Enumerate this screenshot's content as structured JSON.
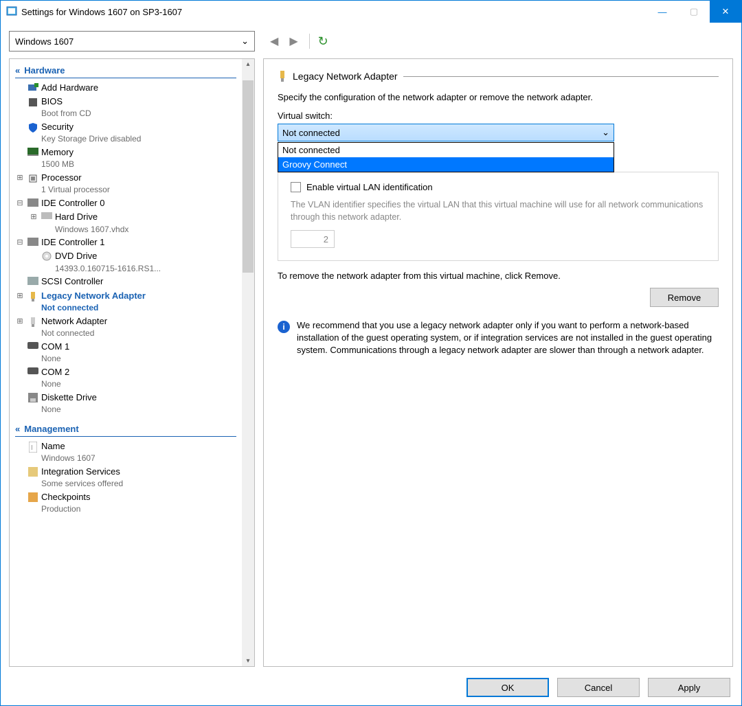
{
  "title": "Settings for Windows 1607 on SP3-1607",
  "vm_selector": "Windows 1607",
  "sidebar": {
    "sections": {
      "hardware": "Hardware",
      "management": "Management"
    },
    "items": {
      "add_hw": "Add Hardware",
      "bios": "BIOS",
      "bios_sub": "Boot from CD",
      "security": "Security",
      "security_sub": "Key Storage Drive disabled",
      "memory": "Memory",
      "memory_sub": "1500 MB",
      "processor": "Processor",
      "processor_sub": "1 Virtual processor",
      "ide0": "IDE Controller 0",
      "hard_drive": "Hard Drive",
      "hard_drive_sub": "Windows 1607.vhdx",
      "ide1": "IDE Controller 1",
      "dvd": "DVD Drive",
      "dvd_sub": "14393.0.160715-1616.RS1...",
      "scsi": "SCSI Controller",
      "legacy_na": "Legacy Network Adapter",
      "legacy_na_sub": "Not connected",
      "net_adapter": "Network Adapter",
      "net_adapter_sub": "Not connected",
      "com1": "COM 1",
      "com1_sub": "None",
      "com2": "COM 2",
      "com2_sub": "None",
      "diskette": "Diskette Drive",
      "diskette_sub": "None",
      "name": "Name",
      "name_sub": "Windows 1607",
      "integ": "Integration Services",
      "integ_sub": "Some services offered",
      "checkpoints": "Checkpoints",
      "checkpoints_sub": "Production"
    }
  },
  "panel": {
    "title": "Legacy Network Adapter",
    "desc": "Specify the configuration of the network adapter or remove the network adapter.",
    "vswitch_label": "Virtual switch:",
    "vswitch_value": "Not connected",
    "vswitch_options": {
      "o0": "Not connected",
      "o1": "Groovy Connect"
    },
    "vlan_check_label": "Enable virtual LAN identification",
    "vlan_desc": "The VLAN identifier specifies the virtual LAN that this virtual machine will use for all network communications through this network adapter.",
    "vlan_value": "2",
    "remove_desc": "To remove the network adapter from this virtual machine, click Remove.",
    "remove_btn": "Remove",
    "info": "We recommend that you use a legacy network adapter only if you want to perform a network-based installation of the guest operating system, or if integration services are not installed in the guest operating system. Communications through a legacy network adapter are slower than through a network adapter."
  },
  "footer": {
    "ok": "OK",
    "cancel": "Cancel",
    "apply": "Apply"
  }
}
